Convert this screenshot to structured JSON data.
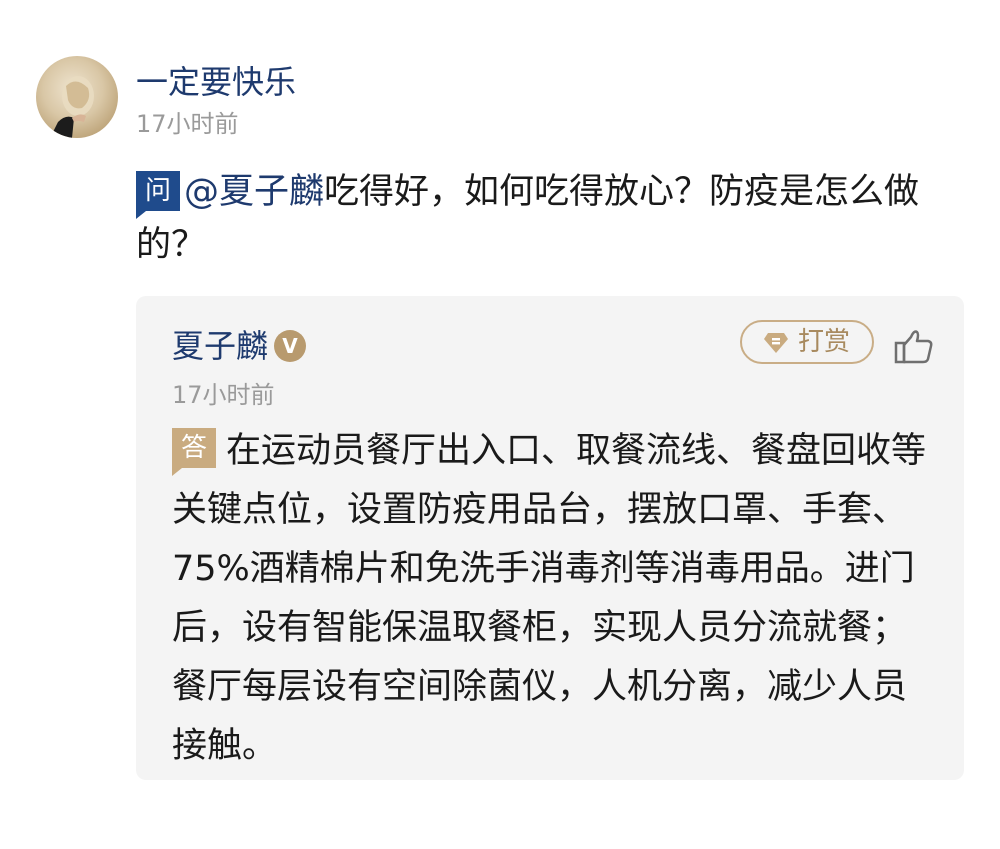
{
  "post": {
    "username": "一定要快乐",
    "time": "17小时前"
  },
  "question": {
    "badge": "问",
    "mention": "@夏子麟",
    "text": "吃得好，如何吃得放心？防疫是怎么做的？"
  },
  "answer": {
    "author": "夏子麟",
    "verified_badge": "V",
    "time": "17小时前",
    "tip_label": "打赏",
    "badge": "答",
    "text": "在运动员餐厅出入口、取餐流线、餐盘回收等关键点位，设置防疫用品台，摆放口罩、手套、75%酒精棉片和免洗手消毒剂等消毒用品。进门后，设有智能保温取餐柜，实现人员分流就餐；餐厅每层设有空间除菌仪，人机分离，减少人员接触。"
  },
  "icons": {
    "tip": "diamond-coin-icon",
    "like": "thumbs-up-icon"
  },
  "colors": {
    "link_blue": "#1e3a6e",
    "question_badge": "#1f4b8c",
    "answer_badge": "#c9ab80",
    "gold_accent": "#c9ad86",
    "card_bg": "#f4f4f4"
  }
}
